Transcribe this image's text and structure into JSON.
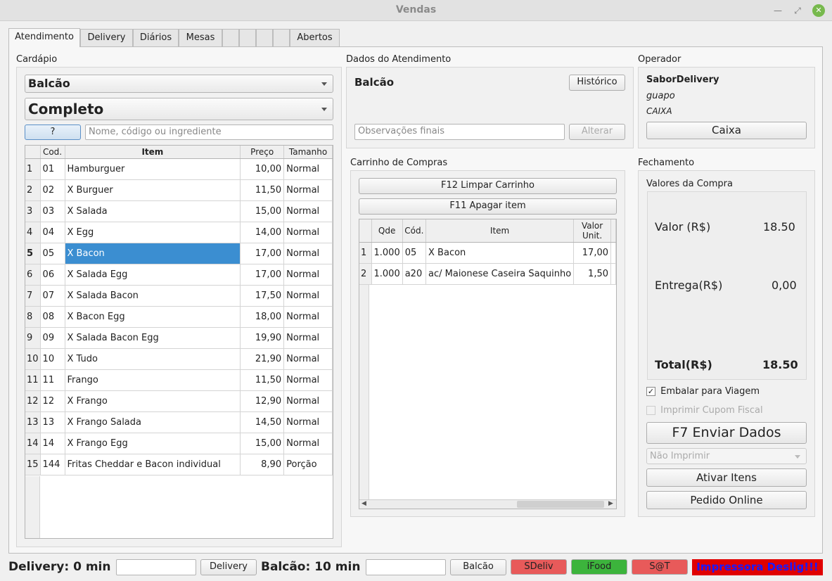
{
  "window": {
    "title": "Vendas",
    "min_icon": "minimize-icon",
    "max_icon": "maximize-icon",
    "close_icon": "close-icon"
  },
  "tabs": [
    "Atendimento",
    "Delivery",
    "Diários",
    "Mesas",
    "",
    "",
    "",
    "Abertos"
  ],
  "cardapio": {
    "label": "Cardápio",
    "local": "Balcão",
    "tipo": "Completo",
    "help_btn": "?",
    "search_placeholder": "Nome, código ou ingrediente",
    "headers": [
      "Cod.",
      "Item",
      "Preço",
      "Tamanho"
    ],
    "rows": [
      {
        "n": "1",
        "cod": "01",
        "item": "Hamburguer",
        "preco": "10,00",
        "tam": "Normal"
      },
      {
        "n": "2",
        "cod": "02",
        "item": "X Burguer",
        "preco": "11,50",
        "tam": "Normal"
      },
      {
        "n": "3",
        "cod": "03",
        "item": "X Salada",
        "preco": "15,00",
        "tam": "Normal"
      },
      {
        "n": "4",
        "cod": "04",
        "item": "X Egg",
        "preco": "14,00",
        "tam": "Normal"
      },
      {
        "n": "5",
        "cod": "05",
        "item": "X Bacon",
        "preco": "17,00",
        "tam": "Normal"
      },
      {
        "n": "6",
        "cod": "06",
        "item": "X Salada Egg",
        "preco": "17,00",
        "tam": "Normal"
      },
      {
        "n": "7",
        "cod": "07",
        "item": "X Salada Bacon",
        "preco": "17,50",
        "tam": "Normal"
      },
      {
        "n": "8",
        "cod": "08",
        "item": "X Bacon Egg",
        "preco": "18,00",
        "tam": "Normal"
      },
      {
        "n": "9",
        "cod": "09",
        "item": "X Salada Bacon Egg",
        "preco": "19,90",
        "tam": "Normal"
      },
      {
        "n": "10",
        "cod": "10",
        "item": "X Tudo",
        "preco": "21,90",
        "tam": "Normal"
      },
      {
        "n": "11",
        "cod": "11",
        "item": "Frango",
        "preco": "11,50",
        "tam": "Normal"
      },
      {
        "n": "12",
        "cod": "12",
        "item": "X Frango",
        "preco": "12,90",
        "tam": "Normal"
      },
      {
        "n": "13",
        "cod": "13",
        "item": "X Frango Salada",
        "preco": "14,50",
        "tam": "Normal"
      },
      {
        "n": "14",
        "cod": "14",
        "item": "X Frango Egg",
        "preco": "15,00",
        "tam": "Normal"
      },
      {
        "n": "15",
        "cod": "144",
        "item": "Fritas Cheddar e Bacon individual",
        "preco": "8,90",
        "tam": "Porção"
      }
    ]
  },
  "atendimento": {
    "label": "Dados do Atendimento",
    "local": "Balcão",
    "historico_btn": "Histórico",
    "obs_placeholder": "Observações finais",
    "alterar_btn": "Alterar"
  },
  "operador": {
    "label": "Operador",
    "empresa": "SaborDelivery",
    "usuario": "guapo",
    "funcao": "CAIXA",
    "caixa_btn": "Caixa"
  },
  "carrinho": {
    "label": "Carrinho de Compras",
    "limpar_btn": "F12 Limpar Carrinho",
    "apagar_btn": "F11 Apagar item",
    "headers": [
      "Qde",
      "Cód.",
      "Item",
      "Valor Unit."
    ],
    "rows": [
      {
        "n": "1",
        "qde": "1.000",
        "cod": "05",
        "item": "X Bacon",
        "valor": "17,00"
      },
      {
        "n": "2",
        "qde": "1.000",
        "cod": "a20",
        "item": "ac/ Maionese Caseira Saquinho",
        "valor": "1,50"
      }
    ]
  },
  "fechamento": {
    "label": "Fechamento",
    "valores_label": "Valores da Compra",
    "valor_label": "Valor (R$)",
    "valor": "18.50",
    "entrega_label": "Entrega(R$)",
    "entrega": "0,00",
    "total_label": "Total(R$)",
    "total": "18.50",
    "embalar_label": "Embalar para Viagem",
    "embalar_checked": "✓",
    "cupom_label": "Imprimir Cupom Fiscal",
    "enviar_btn": "F7 Enviar Dados",
    "imprimir_select": "Não Imprimir",
    "ativar_btn": "Ativar Itens",
    "pedido_btn": "Pedido Online"
  },
  "status": {
    "delivery_label": "Delivery:",
    "delivery_time": "0 min",
    "delivery_btn": "Delivery",
    "balcao_label": "Balcão:",
    "balcao_time": "10 min",
    "balcao_btn": "Balcão",
    "sdeliv_btn": "SDeliv",
    "ifood_btn": "iFood",
    "sat_btn": "S@T",
    "impressora": "Impressora Deslig!!!",
    "colors": {
      "red": "#e85a5a",
      "green": "#3cb43c",
      "alert_bg": "#e00000",
      "alert_text": "#1a1aff"
    }
  }
}
